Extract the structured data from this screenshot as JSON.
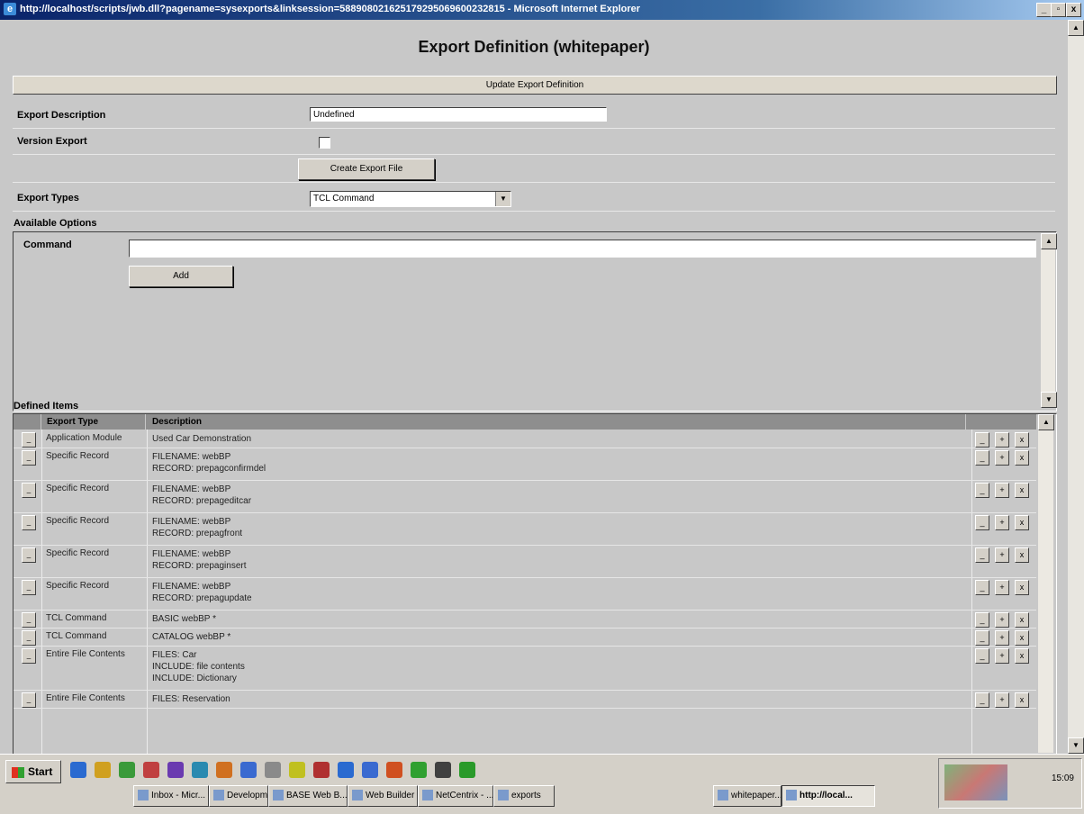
{
  "window": {
    "title": "http://localhost/scripts/jwb.dll?pagename=sysexports&linksession=588908021625179295069600232815 - Microsoft Internet Explorer",
    "min": "_",
    "max": "▫",
    "close": "x"
  },
  "page": {
    "heading": "Export Definition (whitepaper)",
    "update_button": "Update Export Definition",
    "export_description_label": "Export Description",
    "export_description_value": "Undefined",
    "version_export_label": "Version Export",
    "version_export_checked": false,
    "create_button": "Create Export File",
    "export_types_label": "Export Types",
    "export_types_selected": "TCL Command",
    "available_options_label": "Available Options",
    "command_label": "Command",
    "command_value": "",
    "add_button": "Add",
    "defined_items_label": "Defined Items"
  },
  "table": {
    "headers": [
      "Export Type",
      "Description"
    ],
    "rows": [
      {
        "type": "Application Module",
        "desc": [
          "Used Car Demonstration"
        ]
      },
      {
        "type": "Specific Record",
        "desc": [
          "FILENAME: webBP",
          "RECORD: prepagconfirmdel"
        ]
      },
      {
        "type": "Specific Record",
        "desc": [
          "FILENAME: webBP",
          "RECORD: prepageditcar"
        ]
      },
      {
        "type": "Specific Record",
        "desc": [
          "FILENAME: webBP",
          "RECORD: prepagfront"
        ]
      },
      {
        "type": "Specific Record",
        "desc": [
          "FILENAME: webBP",
          "RECORD: prepaginsert"
        ]
      },
      {
        "type": "Specific Record",
        "desc": [
          "FILENAME: webBP",
          "RECORD: prepagupdate"
        ]
      },
      {
        "type": "TCL Command",
        "desc": [
          "BASIC webBP *"
        ]
      },
      {
        "type": "TCL Command",
        "desc": [
          "CATALOG webBP *"
        ]
      },
      {
        "type": "Entire File Contents",
        "desc": [
          "FILES: Car",
          "INCLUDE: file contents",
          "INCLUDE: Dictionary"
        ]
      },
      {
        "type": "Entire File Contents",
        "desc": [
          "FILES: Reservation"
        ]
      }
    ]
  },
  "taskbar": {
    "start": "Start",
    "clock": "15:09",
    "items": [
      {
        "label": "Inbox - Micr..."
      },
      {
        "label": "Developmen..."
      },
      {
        "label": "BASE Web B..."
      },
      {
        "label": "Web Builder ..."
      },
      {
        "label": "NetCentrix - ..."
      },
      {
        "label": "exports"
      },
      {
        "label": "whitepaper...."
      },
      {
        "label": "http://local..."
      }
    ]
  },
  "colors": {
    "titlebar": "#0a246a",
    "page_bg": "#c8c8c8",
    "header_bg": "#8e8e8e"
  }
}
